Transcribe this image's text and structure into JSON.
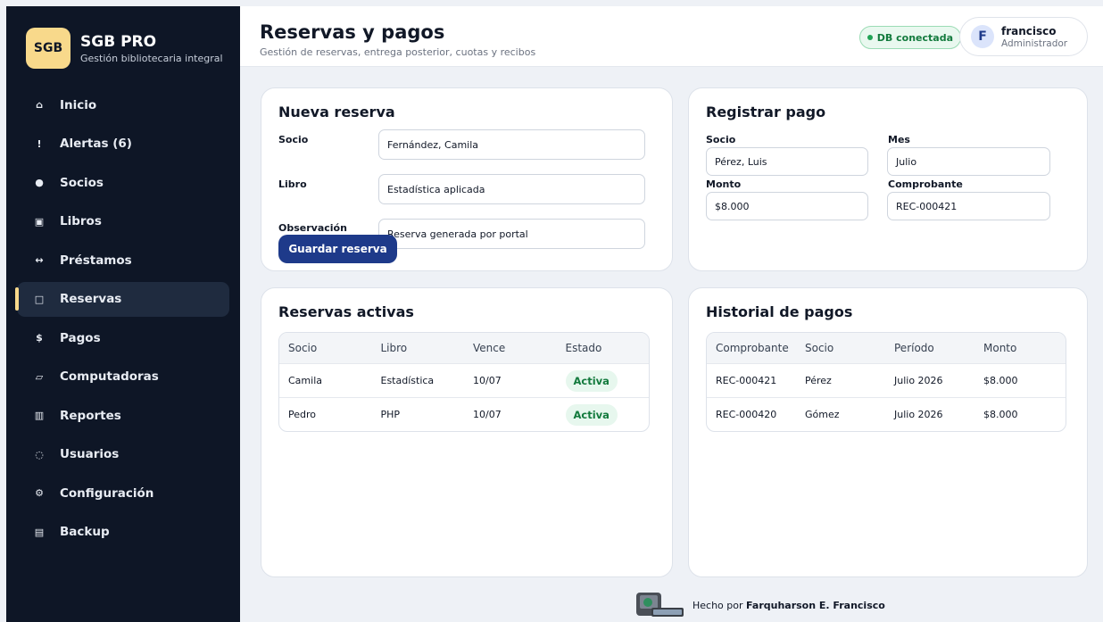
{
  "brand": {
    "badge": "SGB",
    "title": "SGB PRO",
    "subtitle": "Gestión bibliotecaria integral"
  },
  "nav": [
    {
      "label": "Inicio",
      "icon": "home-icon",
      "glyph": "⌂"
    },
    {
      "label": "Alertas (6)",
      "icon": "alert-icon",
      "glyph": "!"
    },
    {
      "label": "Socios",
      "icon": "user-dot-icon",
      "glyph": "●"
    },
    {
      "label": "Libros",
      "icon": "book-icon",
      "glyph": "▣"
    },
    {
      "label": "Préstamos",
      "icon": "swap-arrows-icon",
      "glyph": "↔"
    },
    {
      "label": "Reservas",
      "icon": "calendar-square-icon",
      "glyph": "□"
    },
    {
      "label": "Pagos",
      "icon": "dollar-icon",
      "glyph": "$"
    },
    {
      "label": "Computadoras",
      "icon": "monitor-icon",
      "glyph": "▱"
    },
    {
      "label": "Reportes",
      "icon": "report-icon",
      "glyph": "▥"
    },
    {
      "label": "Usuarios",
      "icon": "users-icon",
      "glyph": "◌"
    },
    {
      "label": "Configuración",
      "icon": "gear-icon",
      "glyph": "⚙"
    },
    {
      "label": "Backup",
      "icon": "database-icon",
      "glyph": "▤"
    }
  ],
  "header": {
    "title": "Reservas y pagos",
    "subtitle": "Gestión de reservas, entrega posterior, cuotas y recibos",
    "db_status": "DB conectada",
    "user": {
      "initial": "F",
      "name": "francisco",
      "role": "Administrador"
    }
  },
  "reserva": {
    "title": "Nueva reserva",
    "socio_label": "Socio",
    "socio_value": "Fernández, Camila",
    "libro_label": "Libro",
    "libro_value": "Estadística aplicada",
    "obs_label": "Observación",
    "obs_value": "Reserva generada por portal",
    "save_label": "Guardar reserva"
  },
  "pago": {
    "title": "Registrar pago",
    "socio_label": "Socio",
    "socio_value": "Pérez, Luis",
    "mes_label": "Mes",
    "mes_value": "Julio",
    "monto_label": "Monto",
    "monto_value": "$8.000",
    "comprobante_label": "Comprobante",
    "comprobante_value": "REC-000421"
  },
  "reservas_activas": {
    "title": "Reservas activas",
    "headers": [
      "Socio",
      "Libro",
      "Vence",
      "Estado"
    ],
    "rows": [
      [
        "Camila",
        "Estadística",
        "10/07",
        "Activa"
      ],
      [
        "Pedro",
        "PHP",
        "10/07",
        "Activa"
      ]
    ]
  },
  "historial": {
    "title": "Historial de pagos",
    "headers": [
      "Comprobante",
      "Socio",
      "Período",
      "Monto"
    ],
    "rows": [
      [
        "REC-000421",
        "Pérez",
        "Julio 2026",
        "$8.000"
      ],
      [
        "REC-000420",
        "Gómez",
        "Julio 2026",
        "$8.000"
      ]
    ]
  },
  "footer": {
    "prefix": "Hecho por",
    "author": "Farquharson E. Francisco"
  },
  "colors": {
    "sidebar": "#0e1626",
    "accent": "#f8d98b",
    "primary": "#1e3a8a",
    "success": "#137a3d"
  }
}
